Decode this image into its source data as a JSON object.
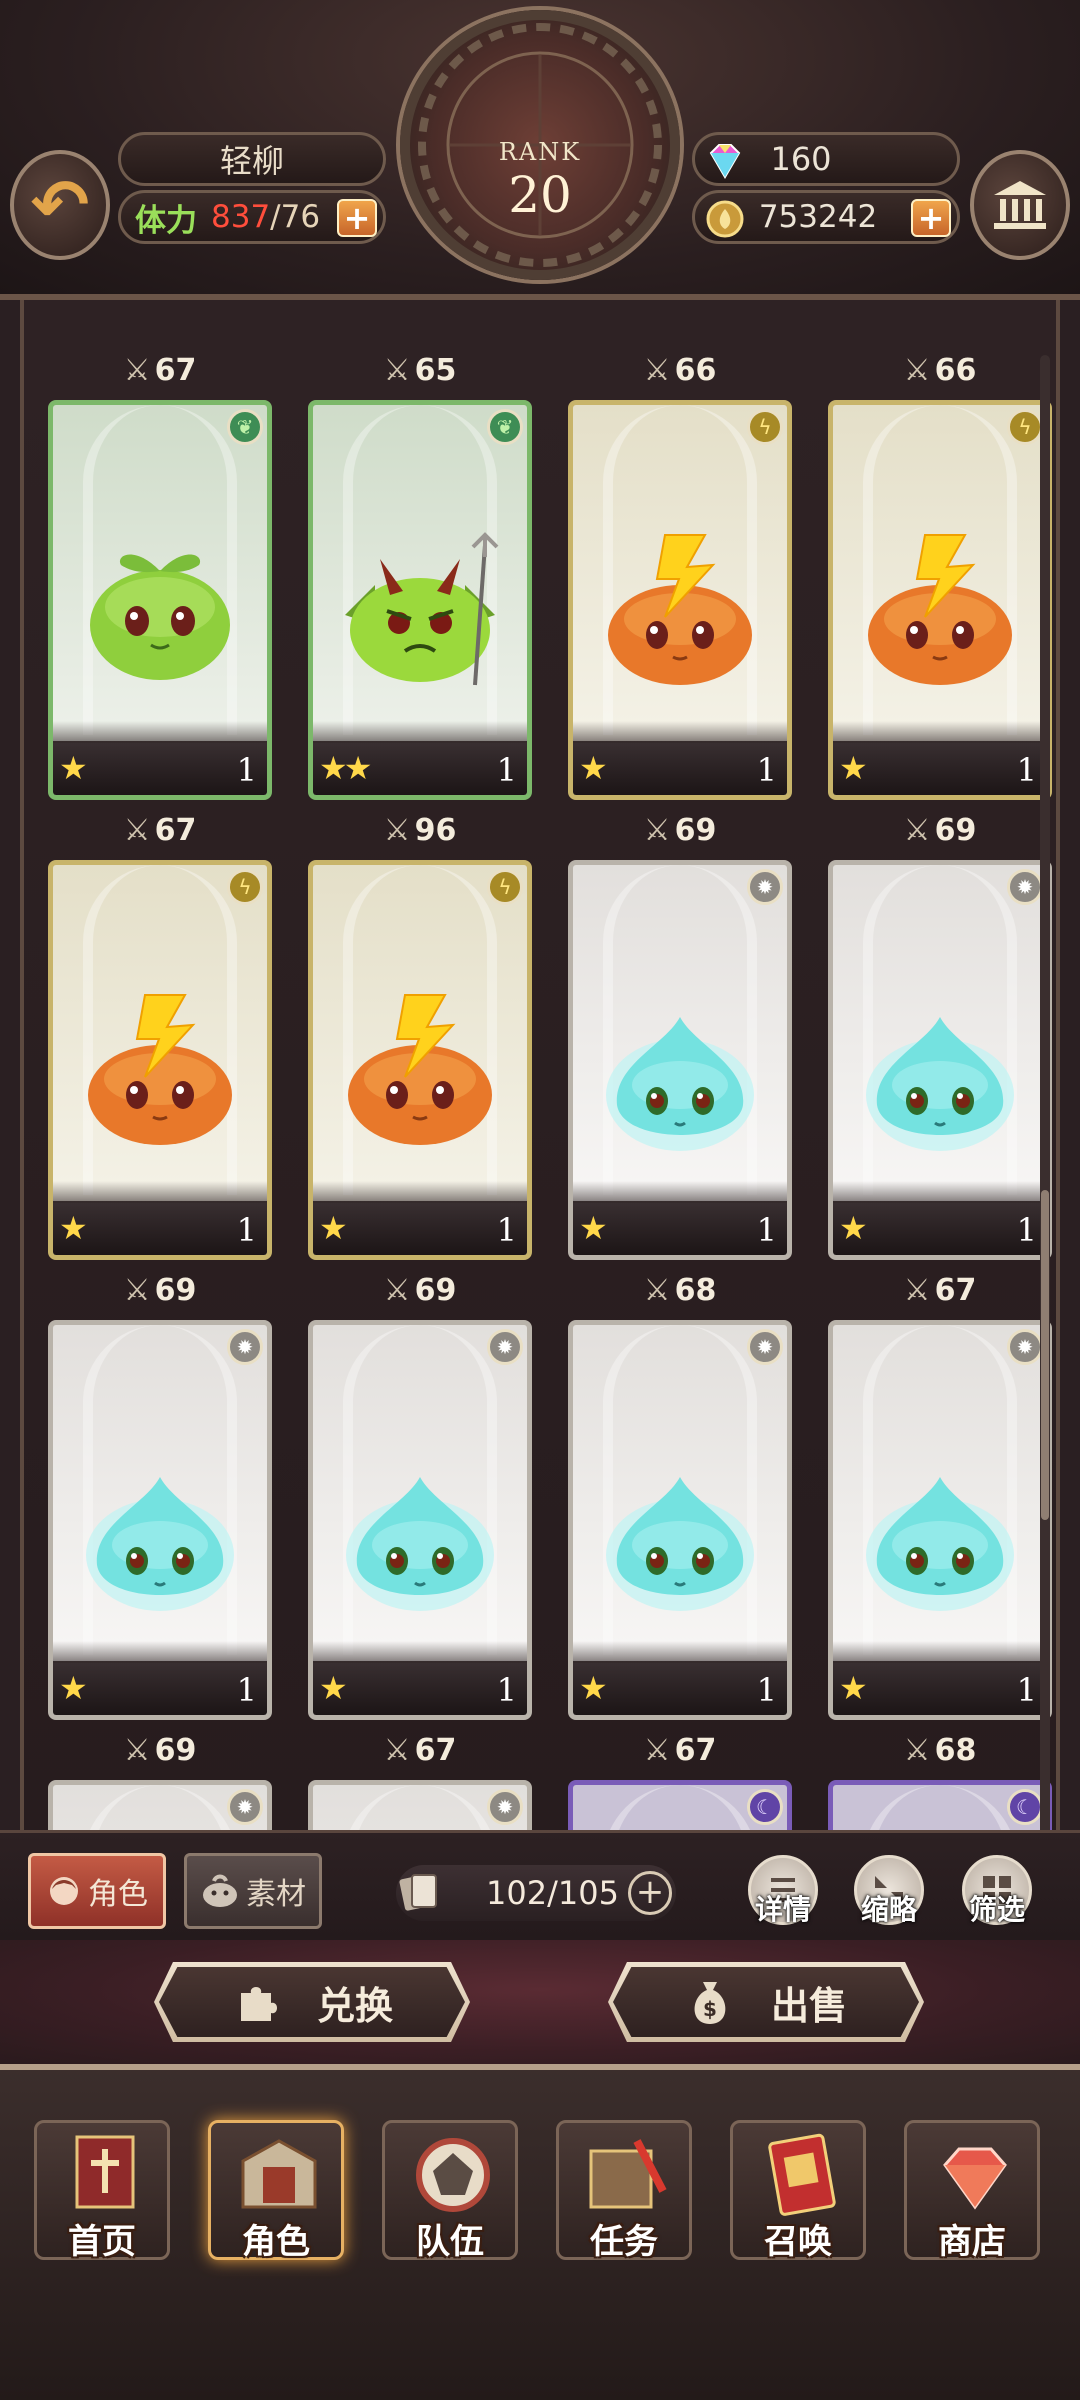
{
  "header": {
    "player_name": "轻柳",
    "stamina_label": "体力",
    "stamina_current": "837",
    "stamina_max": "/76",
    "gems": "160",
    "gold": "753242",
    "rank_label": "RANK",
    "rank_value": "20"
  },
  "cards": [
    {
      "power": "67",
      "element": "grass",
      "monster": "sprout",
      "stars": "★",
      "level": "1"
    },
    {
      "power": "65",
      "element": "grass",
      "monster": "demon",
      "stars": "★★",
      "level": "1"
    },
    {
      "power": "66",
      "element": "thunder",
      "monster": "bolt",
      "stars": "★",
      "level": "1"
    },
    {
      "power": "66",
      "element": "thunder",
      "monster": "bolt",
      "stars": "★",
      "level": "1"
    },
    {
      "power": "67",
      "element": "thunder",
      "monster": "bolt",
      "stars": "★",
      "level": "1"
    },
    {
      "power": "96",
      "element": "thunder",
      "monster": "bolt",
      "stars": "★",
      "level": "1"
    },
    {
      "power": "69",
      "element": "light",
      "monster": "water",
      "stars": "★",
      "level": "1"
    },
    {
      "power": "69",
      "element": "light",
      "monster": "water",
      "stars": "★",
      "level": "1"
    },
    {
      "power": "69",
      "element": "light",
      "monster": "water",
      "stars": "★",
      "level": "1"
    },
    {
      "power": "69",
      "element": "light",
      "monster": "water",
      "stars": "★",
      "level": "1"
    },
    {
      "power": "68",
      "element": "light",
      "monster": "water",
      "stars": "★",
      "level": "1"
    },
    {
      "power": "67",
      "element": "light",
      "monster": "water",
      "stars": "★",
      "level": "1"
    },
    {
      "power": "69",
      "element": "light",
      "monster": "",
      "stars": "",
      "level": ""
    },
    {
      "power": "67",
      "element": "light",
      "monster": "",
      "stars": "",
      "level": ""
    },
    {
      "power": "67",
      "element": "dark",
      "monster": "",
      "stars": "",
      "level": ""
    },
    {
      "power": "68",
      "element": "dark",
      "monster": "",
      "stars": "",
      "level": ""
    }
  ],
  "filter_bar": {
    "tab_role": "角色",
    "tab_material": "素材",
    "capacity": "102/105",
    "details_label": "详情",
    "compact_label": "缩略",
    "filter_label": "筛选"
  },
  "actions": {
    "exchange_label": "兑换",
    "sell_label": "出售"
  },
  "bottom_nav": [
    {
      "label": "首页",
      "icon": "home-banner-icon"
    },
    {
      "label": "角色",
      "icon": "character-box-icon"
    },
    {
      "label": "队伍",
      "icon": "team-dice-icon"
    },
    {
      "label": "任务",
      "icon": "quest-book-icon"
    },
    {
      "label": "召唤",
      "icon": "summon-card-icon"
    },
    {
      "label": "商店",
      "icon": "shop-diamond-icon"
    }
  ],
  "colors": {
    "grass": "#7cb86a",
    "thunder": "#c8b46a",
    "light": "#b9b3aa",
    "dark": "#7a5cb8",
    "accent": "#e79d3e",
    "stamina_current": "#ff4e3c"
  }
}
